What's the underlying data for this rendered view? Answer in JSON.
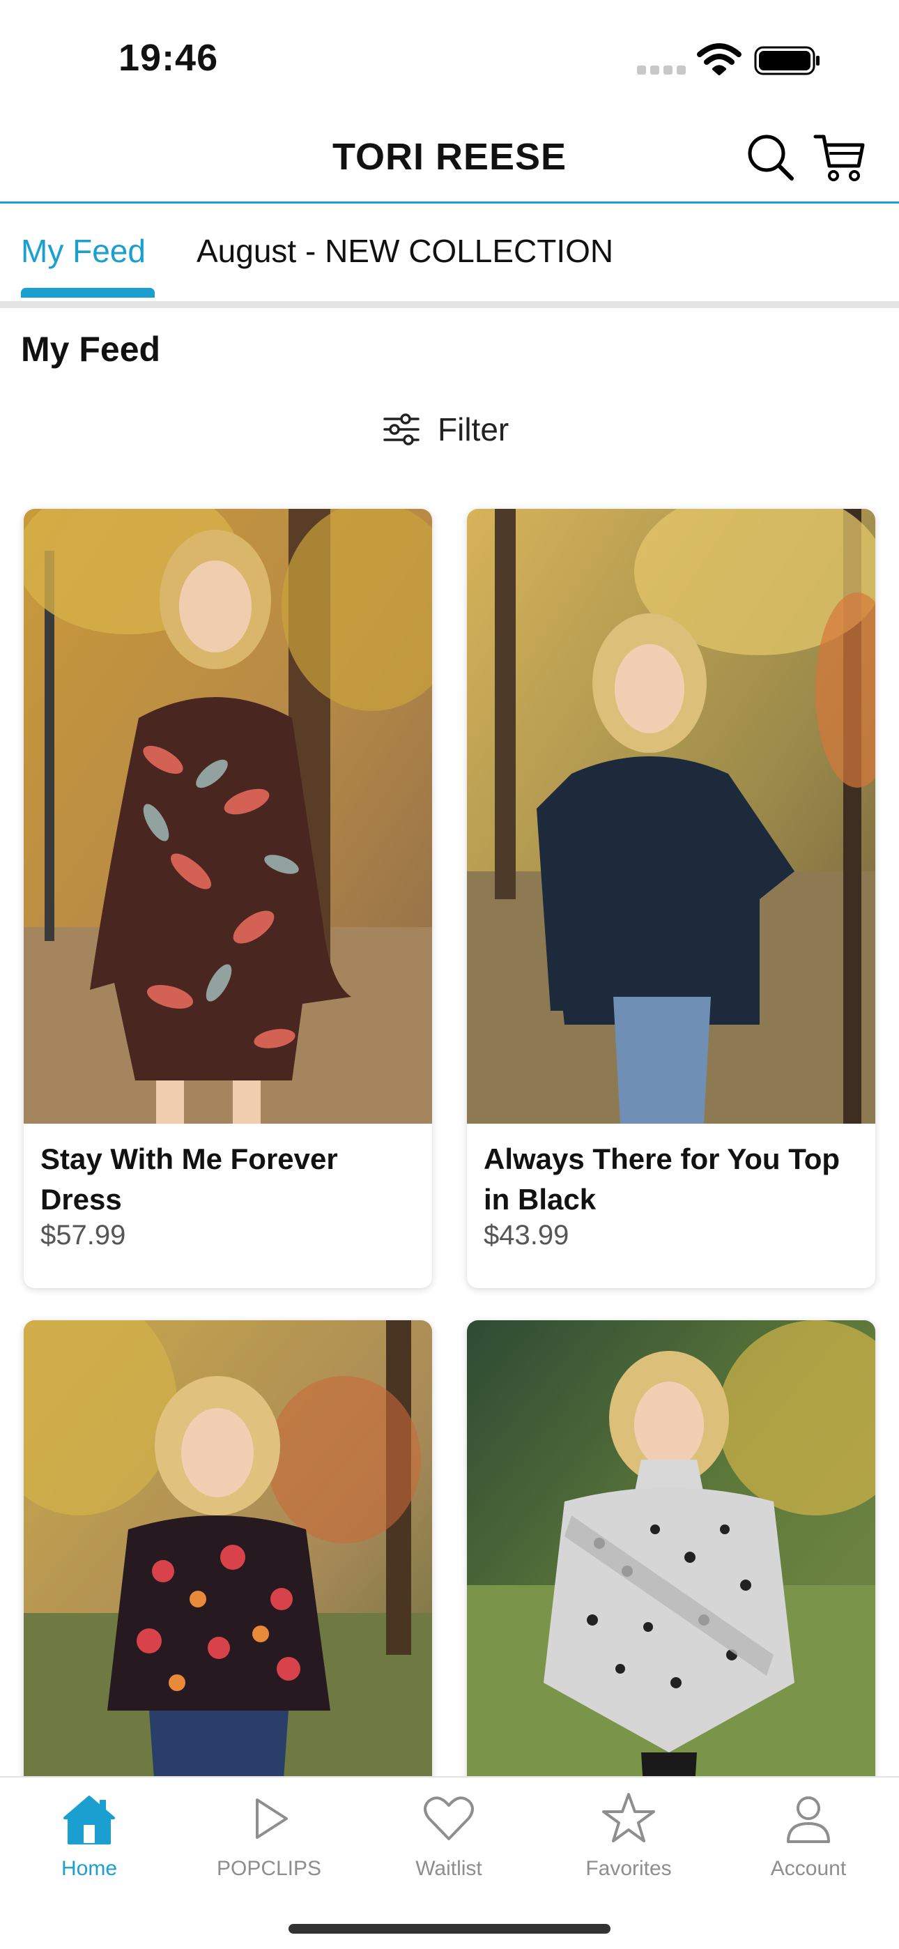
{
  "status_bar": {
    "time": "19:46"
  },
  "header": {
    "brand": "TORI REESE",
    "icons": {
      "search": "search-icon",
      "cart": "cart-icon"
    }
  },
  "tabs": [
    {
      "label": "My Feed",
      "active": true
    },
    {
      "label": "August  - NEW COLLECTION",
      "active": false
    }
  ],
  "section": {
    "title": "My Feed"
  },
  "filter": {
    "label": "Filter",
    "icon": "sliders-icon"
  },
  "products": [
    {
      "title": "Stay With Me Forever Dress",
      "price": "$57.99"
    },
    {
      "title": "Always There for You Top in Black",
      "price": "$43.99"
    },
    {
      "title": "",
      "price": ""
    },
    {
      "title": "",
      "price": ""
    }
  ],
  "bottom_nav": [
    {
      "label": "Home",
      "icon": "home-icon",
      "active": true
    },
    {
      "label": "POPCLIPS",
      "icon": "play-icon",
      "active": false
    },
    {
      "label": "Waitlist",
      "icon": "heart-icon",
      "active": false
    },
    {
      "label": "Favorites",
      "icon": "star-icon",
      "active": false
    },
    {
      "label": "Account",
      "icon": "person-icon",
      "active": false
    }
  ],
  "colors": {
    "accent": "#1b9fd1",
    "inactive": "#8e8e8e",
    "divider": "#e4e4e4"
  }
}
